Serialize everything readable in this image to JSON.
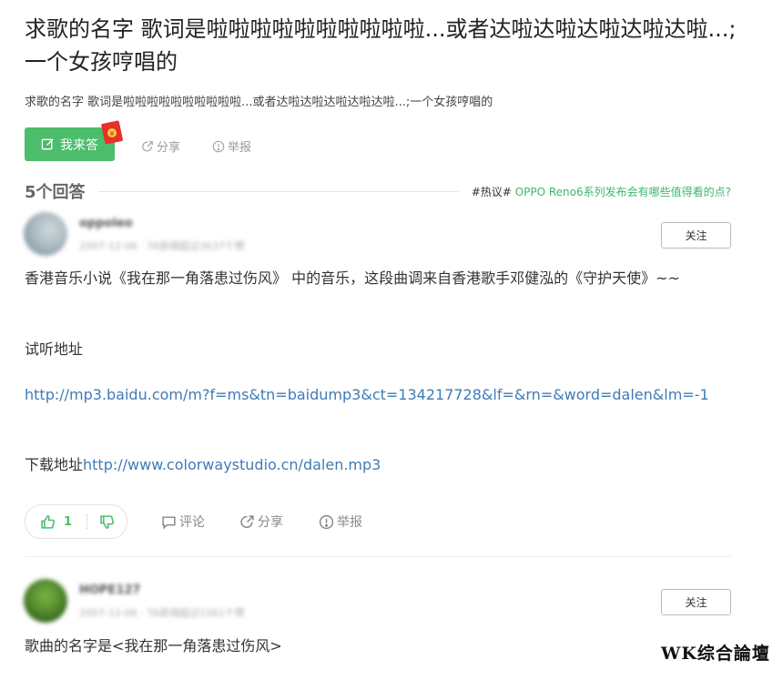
{
  "question": {
    "title": "求歌的名字 歌词是啦啦啦啦啦啦啦啦啦啦...或者达啦达啦达啦达啦达啦...;一个女孩哼唱的",
    "description": "求歌的名字 歌词是啦啦啦啦啦啦啦啦啦啦...或者达啦达啦达啦达啦达啦...;一个女孩哼唱的",
    "answer_button": "我来答",
    "share": "分享",
    "report": "举报"
  },
  "answers_header": {
    "count": "5个回答",
    "hot_tag": "#热议#",
    "hot_topic": "OPPO Reno6系列发布会有哪些值得看的点?"
  },
  "answers": [
    {
      "user": "oppoleo",
      "meta": "2007-12-06 · TA获得超过3637个赞",
      "follow": "关注",
      "p1": "香港音乐小说《我在那一角落患过伤风》 中的音乐，这段曲调来自香港歌手邓健泓的《守护天使》~~",
      "p2": "试听地址",
      "p3_link": "http://mp3.baidu.com/m?f=ms&tn=baidump3&ct=134217728&lf=&rn=&word=dalen&lm=-1",
      "p4_prefix": "下载地址",
      "p4_link": "http://www.colorwaystudio.cn/dalen.mp3",
      "likes": "1",
      "comment": "评论",
      "share": "分享",
      "report": "举报"
    },
    {
      "user": "HOPE127",
      "meta": "2007-12-06 · TA获得超过1561个赞",
      "follow": "关注",
      "p1": "歌曲的名字是<我在那一角落患过伤风>"
    }
  ],
  "watermark": "WK综合論壇",
  "colors": {
    "accent_green": "#4cbd6a",
    "link_blue": "#3f7bb8",
    "hot_green": "#3cb46e"
  }
}
